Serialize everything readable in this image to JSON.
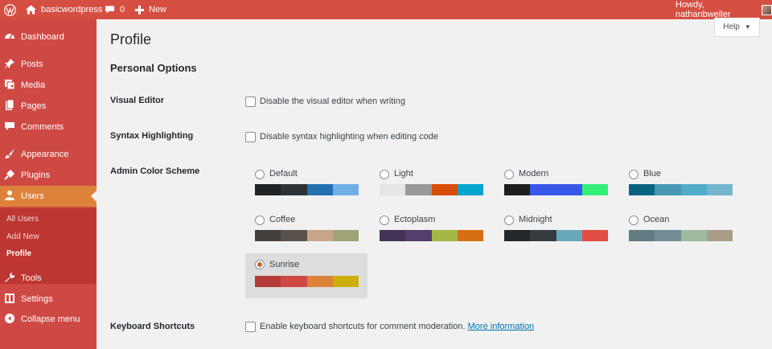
{
  "admin_bar": {
    "site_name": "basicwordpress",
    "comments_count": "0",
    "new_label": "New",
    "greeting": "Howdy, nathanbweller"
  },
  "sidebar": {
    "items": [
      {
        "label": "Dashboard",
        "icon": "dashboard-icon"
      },
      {
        "label": "Posts",
        "icon": "pin-icon"
      },
      {
        "label": "Media",
        "icon": "media-icon"
      },
      {
        "label": "Pages",
        "icon": "pages-icon"
      },
      {
        "label": "Comments",
        "icon": "comment-icon"
      },
      {
        "label": "Appearance",
        "icon": "brush-icon"
      },
      {
        "label": "Plugins",
        "icon": "plug-icon"
      },
      {
        "label": "Users",
        "icon": "users-icon"
      },
      {
        "label": "Tools",
        "icon": "wrench-icon"
      },
      {
        "label": "Settings",
        "icon": "settings-icon"
      },
      {
        "label": "Collapse menu",
        "icon": "collapse-icon"
      }
    ],
    "submenu": [
      "All Users",
      "Add New",
      "Profile"
    ]
  },
  "help_label": "Help",
  "page_title": "Profile",
  "section_title": "Personal Options",
  "visual_editor": {
    "label": "Visual Editor",
    "option": "Disable the visual editor when writing",
    "checked": false
  },
  "syntax": {
    "label": "Syntax Highlighting",
    "option": "Disable syntax highlighting when editing code",
    "checked": false
  },
  "color_scheme": {
    "label": "Admin Color Scheme",
    "selected": "Sunrise",
    "schemes": [
      {
        "name": "Default",
        "colors": [
          "#1d2327",
          "#2c3338",
          "#2271b1",
          "#72aee6"
        ]
      },
      {
        "name": "Light",
        "colors": [
          "#e5e5e5",
          "#999999",
          "#d64e07",
          "#04a4cc"
        ]
      },
      {
        "name": "Modern",
        "colors": [
          "#1e1e1e",
          "#3858e9",
          "#3858e9",
          "#33f078"
        ]
      },
      {
        "name": "Blue",
        "colors": [
          "#096484",
          "#4796b3",
          "#52accc",
          "#74b6ce"
        ]
      },
      {
        "name": "Coffee",
        "colors": [
          "#46403c",
          "#59524c",
          "#c7a589",
          "#9ea476"
        ]
      },
      {
        "name": "Ectoplasm",
        "colors": [
          "#413256",
          "#523f6d",
          "#a3b745",
          "#d46f15"
        ]
      },
      {
        "name": "Midnight",
        "colors": [
          "#25282b",
          "#363b3f",
          "#69a8bb",
          "#e14d43"
        ]
      },
      {
        "name": "Ocean",
        "colors": [
          "#627c83",
          "#738e96",
          "#9ebaa0",
          "#aa9d88"
        ]
      },
      {
        "name": "Sunrise",
        "colors": [
          "#b43c38",
          "#cf4944",
          "#dd823b",
          "#ccaf0b"
        ]
      }
    ]
  },
  "keyboard": {
    "label": "Keyboard Shortcuts",
    "option": "Enable keyboard shortcuts for comment moderation.",
    "link": "More information",
    "checked": false
  },
  "colors": {
    "admin_bar": "#d54e42",
    "sidebar": "#cf4944",
    "current": "#dd823b",
    "submenu": "#be3631",
    "link": "#0073aa"
  }
}
